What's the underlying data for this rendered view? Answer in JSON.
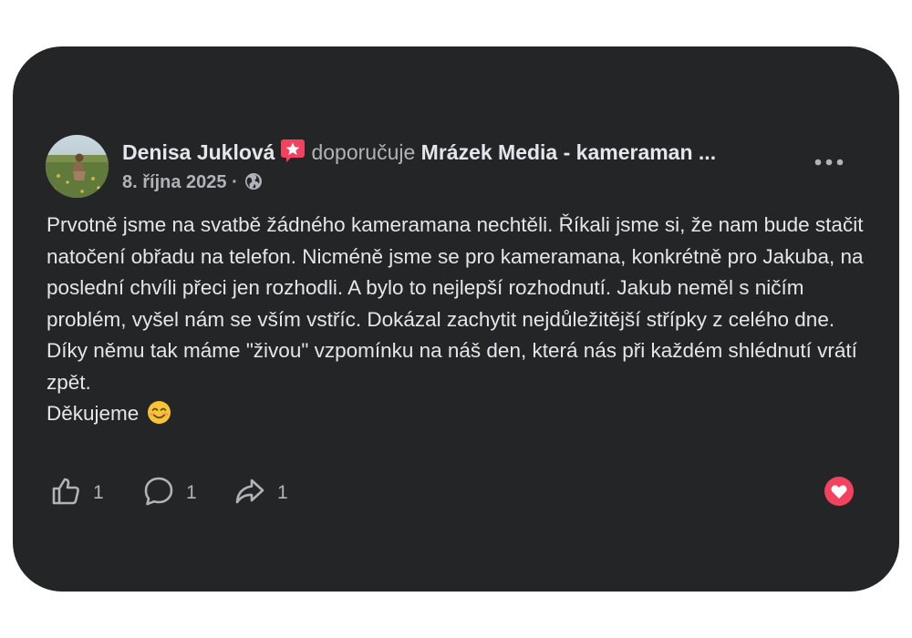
{
  "post": {
    "author": "Denisa Juklová",
    "action_text": "doporučuje",
    "page_name": "Mrázek Media - kameraman ...",
    "date": "8. října 2025",
    "separator": "·",
    "body": "Prvotně jsme na svatbě žádného kameramana nechtěli. Říkali jsme si, že nam bude stačit natočení obřadu na telefon. Nicméně jsme se pro kameramana, konkrétně pro Jakuba, na poslední chvíli přeci jen rozhodli. A bylo to nejlepší rozhodnutí. Jakub neměl s ničím problém, vyšel nám se vším vstříc. Dokázal zachytit nejdůležitější střípky z celého dne. Díky němu tak máme \"živou\" vzpomínku na náš den, která nás při každém shlédnutí vrátí zpět.",
    "closing": "Děkujeme",
    "icons": {
      "recommend": "recommend-star-icon",
      "privacy": "globe-icon",
      "more": "more-options-icon",
      "emoji": "smiling-face-emoji",
      "reaction": "love-reaction-icon"
    }
  },
  "actions": {
    "like_count": "1",
    "comment_count": "1",
    "share_count": "1"
  },
  "colors": {
    "card_bg": "#242526",
    "primary_text": "#e4e6eb",
    "secondary_text": "#b0b3b8",
    "recommend_badge": "#f3425f",
    "love_reaction": "#f3425f"
  }
}
